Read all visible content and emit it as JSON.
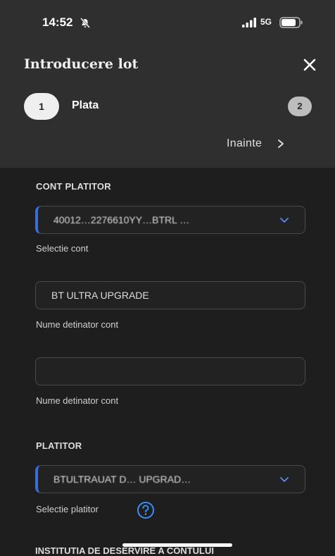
{
  "status_bar": {
    "time": "14:52",
    "network": "5G"
  },
  "header": {
    "title": "Introducere lot",
    "steps": [
      {
        "number": "1",
        "label": "Plata"
      },
      {
        "number": "2"
      }
    ],
    "next_label": "Inainte"
  },
  "form": {
    "cont_platitor": {
      "section_title": "CONT PLATITOR",
      "account_value": "40012…2276610YY…BTRL …",
      "account_hint": "Selectie cont"
    },
    "holder1": {
      "value": "BT ULTRA UPGRADE",
      "hint": "Nume detinator cont"
    },
    "holder2": {
      "value": "",
      "hint": "Nume detinator cont"
    },
    "platitor": {
      "section_title": "PLATITOR",
      "value": "BTULTRAUAT D… UPGRAD…",
      "hint": "Selectie platitor"
    },
    "next_section_title": "INSTITUTIA DE DESERVIRE A CONTULUI"
  },
  "colors": {
    "accent": "#3b6dd8",
    "header_bg": "#2f2f2f",
    "body_bg": "#1e1e1e"
  }
}
